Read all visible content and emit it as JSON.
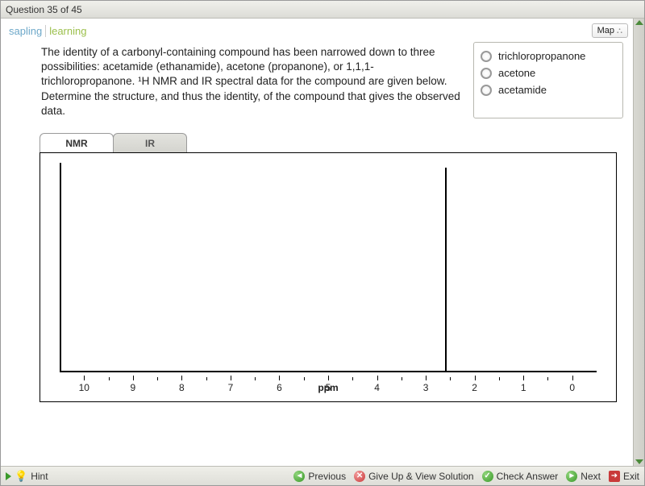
{
  "titlebar": "Question 35 of 45",
  "brand": {
    "part1": "sapling",
    "part2": "learning"
  },
  "map_button": "Map",
  "question_text": "The identity of a carbonyl-containing compound has been narrowed down to three possibilities: acetamide (ethanamide), acetone (propanone), or 1,1,1-trichloropropanone. ¹H NMR and IR spectral data for the compound are given below. Determine the structure, and thus the identity, of the compound that gives the observed data.",
  "answers": [
    "trichloropropanone",
    "acetone",
    "acetamide"
  ],
  "tabs": {
    "nmr": "NMR",
    "ir": "IR",
    "active": "nmr"
  },
  "chart_data": {
    "type": "nmr",
    "xlabel": "ppm",
    "x_ticks": [
      10,
      9,
      8,
      7,
      6,
      5,
      4,
      3,
      2,
      1,
      0
    ],
    "x_range": [
      10.5,
      -0.5
    ],
    "peaks": [
      {
        "ppm": 2.6,
        "relative_height": 1.0
      }
    ]
  },
  "footer": {
    "hint": "Hint",
    "previous": "Previous",
    "giveup": "Give Up & View Solution",
    "check": "Check Answer",
    "next": "Next",
    "exit": "Exit"
  }
}
